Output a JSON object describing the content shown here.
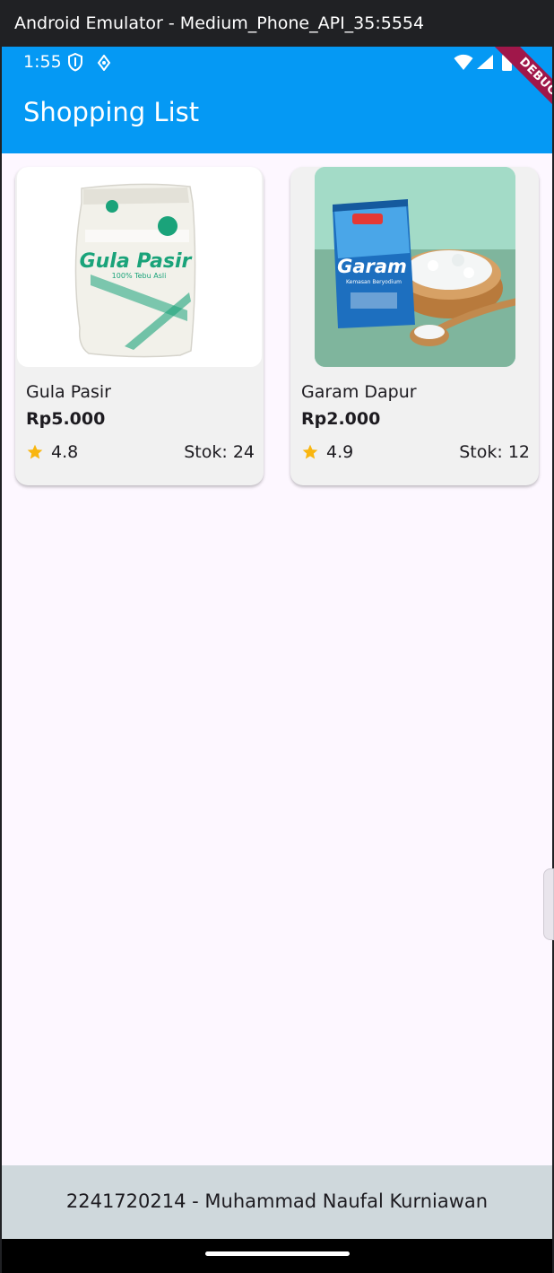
{
  "window": {
    "title": "Android Emulator - Medium_Phone_API_35:5554"
  },
  "status_bar": {
    "time": "1:55",
    "icons": [
      "shield-icon",
      "location-icon",
      "wifi-icon",
      "signal-icon",
      "battery-icon"
    ]
  },
  "debug_banner": {
    "label": "DEBUG"
  },
  "app_bar": {
    "title": "Shopping List",
    "color": "#0599f4"
  },
  "products": [
    {
      "name": "Gula Pasir",
      "price": "Rp5.000",
      "rating": "4.8",
      "stock": "Stok: 24",
      "package_brand": "Gula Pasir",
      "package_subtitle": "100% Tebu Asli"
    },
    {
      "name": "Garam Dapur",
      "price": "Rp2.000",
      "rating": "4.9",
      "stock": "Stok: 12",
      "package_brand": "Garam",
      "package_subtitle": "Kemasan Beryodium"
    }
  ],
  "footer": {
    "text": "2241720214 - Muhammad Naufal Kurniawan",
    "color": "#cfd8dc"
  },
  "colors": {
    "star": "#f9b60f",
    "background": "#fdf7ff",
    "card": "#f1f1f1"
  }
}
